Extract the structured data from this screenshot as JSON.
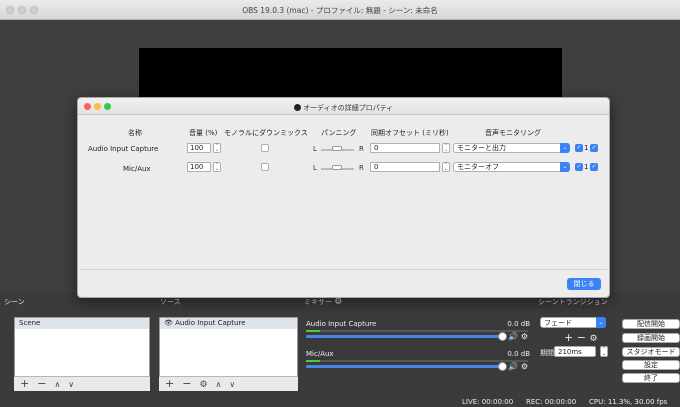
{
  "window": {
    "title": "OBS 19.0.3 (mac) - プロファイル: 無題 - シーン: 未命名"
  },
  "panels": {
    "scenes": "シーン",
    "sources": "ソース",
    "mixer": "ミキサー",
    "transitions": "シーントランジション"
  },
  "scenes": {
    "items": [
      "Scene"
    ]
  },
  "sources": {
    "items": [
      "Audio Input Capture"
    ]
  },
  "mixer": {
    "channels": [
      {
        "name": "Audio Input Capture",
        "db": "0.0 dB"
      },
      {
        "name": "Mic/Aux",
        "db": "0.0 dB"
      }
    ]
  },
  "transitions": {
    "selected": "フェード",
    "duration_label": "期間",
    "duration_value": "210ms"
  },
  "controls": [
    "配信開始",
    "録画開始",
    "スタジオモード",
    "設定",
    "終了"
  ],
  "status": {
    "live": "LIVE: 00:00:00",
    "rec": "REC: 00:00:00",
    "cpu": "CPU: 11.3%, 30.00 fps"
  },
  "dialog": {
    "title": "オーディオの詳細プロパティ",
    "headers": {
      "name": "名称",
      "volume": "音量 (%)",
      "mono": "モノラルにダウンミックス",
      "panning": "パンニング",
      "sync": "同期オフセット (ミリ秒)",
      "monitor": "音声モニタリング"
    },
    "rows": [
      {
        "name": "Audio Input Capture",
        "volume": "100",
        "pan_l": "L",
        "pan_r": "R",
        "offset": "0",
        "monitor": "モニターと出力",
        "track1": "1"
      },
      {
        "name": "Mic/Aux",
        "volume": "100",
        "pan_l": "L",
        "pan_r": "R",
        "offset": "0",
        "monitor": "モニターオフ",
        "track1": "1"
      }
    ],
    "close_label": "閉じる"
  },
  "colors": {
    "accent": "#3b82f6",
    "meter": "#55c83a"
  },
  "icons": {
    "plus": "+",
    "minus": "−",
    "up": "∧",
    "down": "∨",
    "gear": "⚙",
    "eye": "👁",
    "speaker": "🔊"
  }
}
